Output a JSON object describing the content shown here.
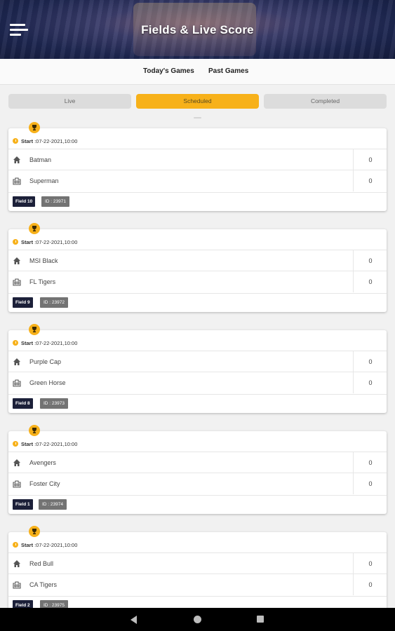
{
  "header": {
    "title": "Fields & Live Score"
  },
  "tabs": [
    {
      "label": "Today's Games",
      "active": true
    },
    {
      "label": "Past Games",
      "active": false
    }
  ],
  "filters": [
    {
      "label": "Live",
      "selected": false
    },
    {
      "label": "Scheduled",
      "selected": true
    },
    {
      "label": "Completed",
      "selected": false
    }
  ],
  "colors": {
    "accent": "#f7b11a",
    "field_badge": "#1c2039",
    "id_badge": "#737373"
  },
  "games": [
    {
      "start_label": "Start",
      "start_value": ":07-22-2021,10:00",
      "home_team": "Batman",
      "home_score": "0",
      "away_team": "Superman",
      "away_score": "0",
      "field": "Field 10",
      "id": "ID : 23971"
    },
    {
      "start_label": "Start",
      "start_value": ":07-22-2021,10:00",
      "home_team": "MSI Black",
      "home_score": "0",
      "away_team": "FL Tigers",
      "away_score": "0",
      "field": "Field 9",
      "id": "ID : 23972"
    },
    {
      "start_label": "Start",
      "start_value": ":07-22-2021,10:00",
      "home_team": "Purple Cap",
      "home_score": "0",
      "away_team": "Green Horse",
      "away_score": "0",
      "field": "Field 8",
      "id": "ID : 23973"
    },
    {
      "start_label": "Start",
      "start_value": ":07-22-2021,10:00",
      "home_team": "Avengers",
      "home_score": "0",
      "away_team": "Foster City",
      "away_score": "0",
      "field": "Field 1",
      "id": "ID : 23974"
    },
    {
      "start_label": "Start",
      "start_value": ":07-22-2021,10:00",
      "home_team": "Red Bull",
      "home_score": "0",
      "away_team": "CA Tigers",
      "away_score": "0",
      "field": "Field 2",
      "id": "ID : 23975"
    }
  ]
}
